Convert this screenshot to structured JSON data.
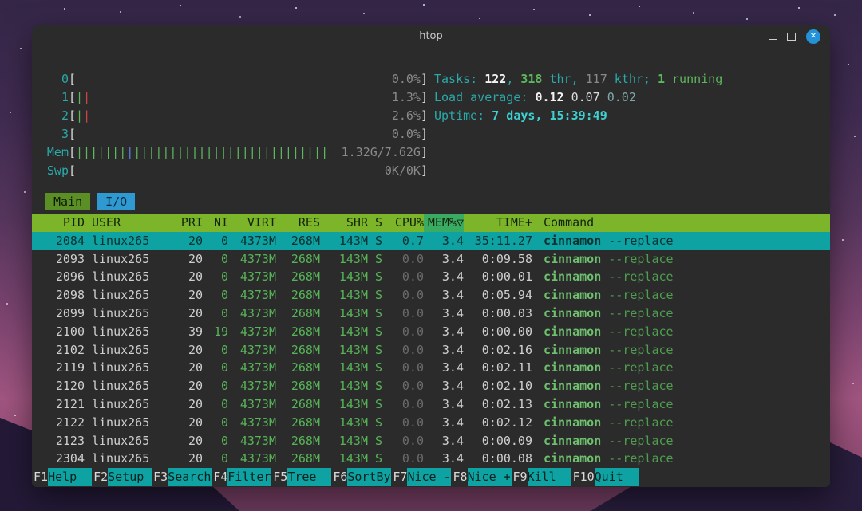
{
  "palette": {
    "terminal_bg": "#2b2b2b",
    "cyan": "#2ba8a8",
    "green": "#5db75d",
    "header_green": "#7db52a",
    "sort_col_green": "#3aab63",
    "selected_row_cyan": "#0ea2a2",
    "fnbar_cyan": "#0ea2a2",
    "close_button_blue": "#2492d8",
    "desktop_purple": "#7c4470"
  },
  "window": {
    "title": "htop",
    "controls": [
      "minimize-icon",
      "maximize-icon",
      "close-icon"
    ]
  },
  "meters": {
    "cpus": [
      {
        "label": "0",
        "value": "0.0%",
        "ticks": []
      },
      {
        "label": "1",
        "value": "1.3%",
        "ticks": [
          "green",
          "red"
        ]
      },
      {
        "label": "2",
        "value": "2.6%",
        "ticks": [
          "green",
          "red"
        ]
      },
      {
        "label": "3",
        "value": "0.0%",
        "ticks": []
      }
    ],
    "mem": {
      "label": "Mem",
      "value": "1.32G/7.62G",
      "segments": [
        {
          "color": "green",
          "count": 7
        },
        {
          "color": "blue",
          "count": 1
        },
        {
          "color": "green",
          "count": 27
        }
      ]
    },
    "swp": {
      "label": "Swp",
      "value": "0K/0K",
      "segments": []
    },
    "right_lines": [
      {
        "name": "tasks-line",
        "segments": [
          {
            "t": "Tasks: ",
            "c": "cyan"
          },
          {
            "t": "122",
            "c": "white-b"
          },
          {
            "t": ", ",
            "c": "cyan"
          },
          {
            "t": "318",
            "c": "green-b"
          },
          {
            "t": " thr, ",
            "c": "cyan"
          },
          {
            "t": "117",
            "c": "dim"
          },
          {
            "t": " kthr; ",
            "c": "cyan"
          },
          {
            "t": "1",
            "c": "green-b"
          },
          {
            "t": " running",
            "c": "green"
          }
        ]
      },
      {
        "name": "load-average-line",
        "segments": [
          {
            "t": "Load average: ",
            "c": "cyan"
          },
          {
            "t": "0.12 ",
            "c": "white-b"
          },
          {
            "t": "0.07 ",
            "c": "white"
          },
          {
            "t": "0.02",
            "c": "cyan-dim"
          }
        ]
      },
      {
        "name": "uptime-line",
        "segments": [
          {
            "t": "Uptime: ",
            "c": "cyan"
          },
          {
            "t": "7 days, 15:39:49",
            "c": "cyan-b"
          }
        ]
      }
    ]
  },
  "tabs": [
    {
      "label": "Main",
      "active": true
    },
    {
      "label": "I/O",
      "active": false
    }
  ],
  "table": {
    "columns": [
      {
        "key": "pid",
        "label": "PID"
      },
      {
        "key": "user",
        "label": "USER"
      },
      {
        "key": "pri",
        "label": "PRI"
      },
      {
        "key": "ni",
        "label": "NI"
      },
      {
        "key": "virt",
        "label": "VIRT"
      },
      {
        "key": "res",
        "label": "RES"
      },
      {
        "key": "shr",
        "label": "SHR"
      },
      {
        "key": "s",
        "label": "S"
      },
      {
        "key": "cpu",
        "label": "CPU%"
      },
      {
        "key": "mem",
        "label": "MEM%▽",
        "sort": true
      },
      {
        "key": "time",
        "label": "TIME+"
      },
      {
        "key": "cmd",
        "label": "Command"
      }
    ],
    "rows": [
      {
        "pid": "2084",
        "user": "linux265",
        "pri": "20",
        "ni": "0",
        "virt": "4373M",
        "res": "268M",
        "shr": "143M",
        "s": "S",
        "cpu": "0.7",
        "mem": "3.4",
        "time": "35:11.27",
        "cmd": "cinnamon",
        "args": "--replace",
        "selected": true
      },
      {
        "pid": "2093",
        "user": "linux265",
        "pri": "20",
        "ni": "0",
        "virt": "4373M",
        "res": "268M",
        "shr": "143M",
        "s": "S",
        "cpu": "0.0",
        "mem": "3.4",
        "time": "0:09.58",
        "cmd": "cinnamon",
        "args": "--replace",
        "selected": false
      },
      {
        "pid": "2096",
        "user": "linux265",
        "pri": "20",
        "ni": "0",
        "virt": "4373M",
        "res": "268M",
        "shr": "143M",
        "s": "S",
        "cpu": "0.0",
        "mem": "3.4",
        "time": "0:00.01",
        "cmd": "cinnamon",
        "args": "--replace",
        "selected": false
      },
      {
        "pid": "2098",
        "user": "linux265",
        "pri": "20",
        "ni": "0",
        "virt": "4373M",
        "res": "268M",
        "shr": "143M",
        "s": "S",
        "cpu": "0.0",
        "mem": "3.4",
        "time": "0:05.94",
        "cmd": "cinnamon",
        "args": "--replace",
        "selected": false
      },
      {
        "pid": "2099",
        "user": "linux265",
        "pri": "20",
        "ni": "0",
        "virt": "4373M",
        "res": "268M",
        "shr": "143M",
        "s": "S",
        "cpu": "0.0",
        "mem": "3.4",
        "time": "0:00.03",
        "cmd": "cinnamon",
        "args": "--replace",
        "selected": false
      },
      {
        "pid": "2100",
        "user": "linux265",
        "pri": "39",
        "ni": "19",
        "virt": "4373M",
        "res": "268M",
        "shr": "143M",
        "s": "S",
        "cpu": "0.0",
        "mem": "3.4",
        "time": "0:00.00",
        "cmd": "cinnamon",
        "args": "--replace",
        "selected": false
      },
      {
        "pid": "2102",
        "user": "linux265",
        "pri": "20",
        "ni": "0",
        "virt": "4373M",
        "res": "268M",
        "shr": "143M",
        "s": "S",
        "cpu": "0.0",
        "mem": "3.4",
        "time": "0:02.16",
        "cmd": "cinnamon",
        "args": "--replace",
        "selected": false
      },
      {
        "pid": "2119",
        "user": "linux265",
        "pri": "20",
        "ni": "0",
        "virt": "4373M",
        "res": "268M",
        "shr": "143M",
        "s": "S",
        "cpu": "0.0",
        "mem": "3.4",
        "time": "0:02.11",
        "cmd": "cinnamon",
        "args": "--replace",
        "selected": false
      },
      {
        "pid": "2120",
        "user": "linux265",
        "pri": "20",
        "ni": "0",
        "virt": "4373M",
        "res": "268M",
        "shr": "143M",
        "s": "S",
        "cpu": "0.0",
        "mem": "3.4",
        "time": "0:02.10",
        "cmd": "cinnamon",
        "args": "--replace",
        "selected": false
      },
      {
        "pid": "2121",
        "user": "linux265",
        "pri": "20",
        "ni": "0",
        "virt": "4373M",
        "res": "268M",
        "shr": "143M",
        "s": "S",
        "cpu": "0.0",
        "mem": "3.4",
        "time": "0:02.13",
        "cmd": "cinnamon",
        "args": "--replace",
        "selected": false
      },
      {
        "pid": "2122",
        "user": "linux265",
        "pri": "20",
        "ni": "0",
        "virt": "4373M",
        "res": "268M",
        "shr": "143M",
        "s": "S",
        "cpu": "0.0",
        "mem": "3.4",
        "time": "0:02.12",
        "cmd": "cinnamon",
        "args": "--replace",
        "selected": false
      },
      {
        "pid": "2123",
        "user": "linux265",
        "pri": "20",
        "ni": "0",
        "virt": "4373M",
        "res": "268M",
        "shr": "143M",
        "s": "S",
        "cpu": "0.0",
        "mem": "3.4",
        "time": "0:00.09",
        "cmd": "cinnamon",
        "args": "--replace",
        "selected": false
      },
      {
        "pid": "2304",
        "user": "linux265",
        "pri": "20",
        "ni": "0",
        "virt": "4373M",
        "res": "268M",
        "shr": "143M",
        "s": "S",
        "cpu": "0.0",
        "mem": "3.4",
        "time": "0:00.08",
        "cmd": "cinnamon",
        "args": "--replace",
        "selected": false
      }
    ]
  },
  "fnbar": [
    {
      "key": "F1",
      "label": "Help"
    },
    {
      "key": "F2",
      "label": "Setup"
    },
    {
      "key": "F3",
      "label": "Search"
    },
    {
      "key": "F4",
      "label": "Filter"
    },
    {
      "key": "F5",
      "label": "Tree"
    },
    {
      "key": "F6",
      "label": "SortBy"
    },
    {
      "key": "F7",
      "label": "Nice -"
    },
    {
      "key": "F8",
      "label": "Nice +"
    },
    {
      "key": "F9",
      "label": "Kill"
    },
    {
      "key": "F10",
      "label": "Quit"
    }
  ]
}
